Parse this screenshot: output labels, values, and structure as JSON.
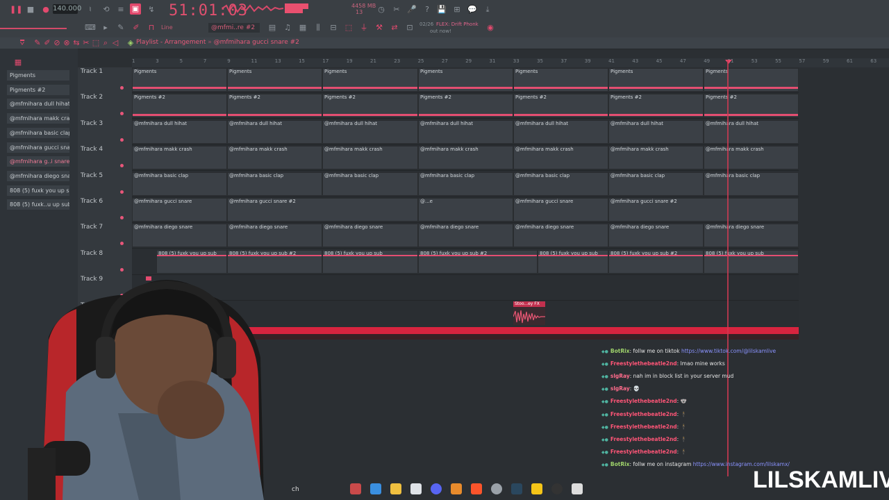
{
  "toolbar": {
    "tempo": "140.000",
    "clock": "51:01:03",
    "mem": "4458 MB",
    "mem_sub": "13",
    "pattern": "@mfmi..re #2",
    "snap": "Line",
    "news_time": "02/26",
    "news": "FLEX: Drift Phonk",
    "news_sub": "out now!"
  },
  "playlist": {
    "title": "Playlist - Arrangement",
    "pattern": "@mfmihara gucci snare #2"
  },
  "ruler": [
    "1",
    "3",
    "5",
    "7",
    "9",
    "11",
    "13",
    "15",
    "17",
    "19",
    "21",
    "23",
    "25",
    "27",
    "29",
    "31",
    "33",
    "35",
    "37",
    "39",
    "41",
    "43",
    "45",
    "47",
    "49",
    "51",
    "53",
    "55",
    "57",
    "59",
    "61",
    "63"
  ],
  "browser": [
    {
      "label": "Pigments",
      "selected": false
    },
    {
      "label": "Pigments #2",
      "selected": false
    },
    {
      "label": "@mfmihara dull hihat",
      "selected": false
    },
    {
      "label": "@mfmihara makk crash",
      "selected": false
    },
    {
      "label": "@mfmihara basic clap",
      "selected": false
    },
    {
      "label": "@mfmihara gucci snare",
      "selected": false
    },
    {
      "label": "@mfmihara g..i snare #2",
      "selected": true
    },
    {
      "label": "@mfmihara diego snare",
      "selected": false
    },
    {
      "label": "808 (5) fuxk you up sub",
      "selected": false
    },
    {
      "label": "808 (5) fuxk..u up sub #2",
      "selected": false
    }
  ],
  "tracks": [
    {
      "name": "Track 1",
      "clips": [
        "Pigments",
        "Pigments",
        "Pigments",
        "Pigments",
        "Pigments",
        "Pigments",
        "Pigments"
      ]
    },
    {
      "name": "Track 2",
      "clips": [
        "Pigments #2",
        "Pigments #2",
        "Pigments #2",
        "Pigments #2",
        "Pigments #2",
        "Pigments #2",
        "Pigments #2"
      ]
    },
    {
      "name": "Track 3",
      "clips": [
        "@mfmihara dull hihat",
        "@mfmihara dull hihat",
        "@mfmihara dull hihat",
        "@mfmihara dull hihat",
        "@mfmihara dull hihat",
        "@mfmihara dull hihat",
        "@mfmihara dull hihat"
      ]
    },
    {
      "name": "Track 4",
      "clips": [
        "@mfmihara makk crash",
        "@mfmihara makk crash",
        "@mfmihara makk crash",
        "@mfmihara makk crash",
        "@mfmihara makk crash",
        "@mfmihara makk crash",
        "@mfmihara makk crash"
      ]
    },
    {
      "name": "Track 5",
      "clips": [
        "@mfmihara basic clap",
        "@mfmihara basic clap",
        "@mfmihara basic clap",
        "@mfmihara basic clap",
        "@mfmihara basic clap",
        "@mfmihara basic clap",
        "@mfmihara basic clap"
      ]
    },
    {
      "name": "Track 6",
      "clips": [
        "@mfmihara gucci snare",
        "@mfmihara gucci snare #2",
        "@...e",
        "@mfmihara gucci snare",
        "@mfmihara gucci snare #2"
      ]
    },
    {
      "name": "Track 7",
      "clips": [
        "@mfmihara diego snare",
        "@mfmihara diego snare",
        "@mfmihara diego snare",
        "@mfmihara diego snare",
        "@mfmihara diego snare",
        "@mfmihara diego snare",
        "@mfmihara diego snare"
      ]
    },
    {
      "name": "Track 8",
      "clips": [
        "808 (5) fuxk you up sub",
        "808 (5) fuxk you up sub #2",
        "808 (5) fuxk you up sub",
        "808 (5) fuxk you up sub #2",
        "808 (5) fuxk you up sub",
        "808 (5) fuxk you up sub #2",
        "808 (5) fuxk you up sub"
      ]
    },
    {
      "name": "Track 9",
      "clips": []
    },
    {
      "name": "Track 10",
      "clips": [
        "Stoo...ey FX"
      ]
    },
    {
      "name": "Track",
      "clips": []
    }
  ],
  "chat": [
    {
      "user": "BotRix",
      "text": ": follw me on tiktok ",
      "link": "https://www.tiktok.com/@lilskamlive"
    },
    {
      "user": "Freestylethebeatle2nd",
      "text": ": lmao mine works",
      "link": ""
    },
    {
      "user": "slgRay",
      "text": ": nah im in block list in your server mud",
      "link": ""
    },
    {
      "user": "slgRay",
      "text": ": 💀",
      "link": ""
    },
    {
      "user": "Freestylethebeatle2nd",
      "text": ": 🐨",
      "link": ""
    },
    {
      "user": "Freestylethebeatle2nd",
      "text": ": 🕴",
      "link": ""
    },
    {
      "user": "Freestylethebeatle2nd",
      "text": ": 🕴",
      "link": ""
    },
    {
      "user": "Freestylethebeatle2nd",
      "text": ": 🕴",
      "link": ""
    },
    {
      "user": "Freestylethebeatle2nd",
      "text": ": 🕴",
      "link": ""
    },
    {
      "user": "BotRix",
      "text": ": follw me on instagram ",
      "link": "https://www.instagram.com/lilskamx/"
    }
  ],
  "taskbar_search": "ch",
  "brand": "LILSKAMLIVE"
}
